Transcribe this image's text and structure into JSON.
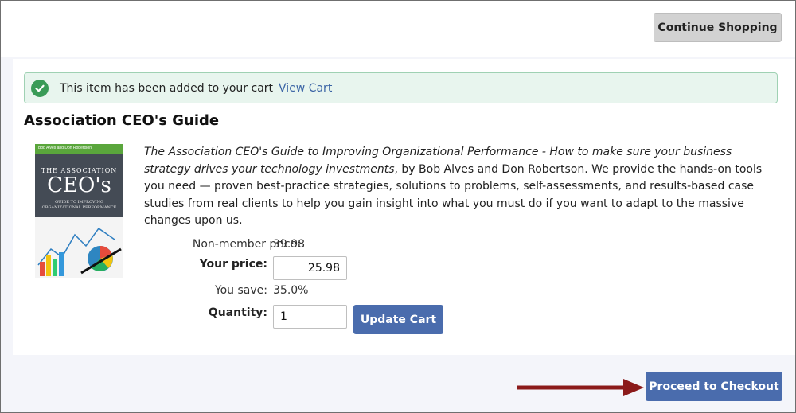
{
  "header": {
    "continue_label": "Continue Shopping"
  },
  "alert": {
    "message": "This item has been added to your cart",
    "link_label": "View Cart"
  },
  "product": {
    "title": "Association CEO's Guide",
    "cover": {
      "authors": "Bob Alves and Don Robertson",
      "line1": "THE ASSOCIATION",
      "line2": "CEO's",
      "subtitle": "GUIDE TO IMPROVING ORGANIZATIONAL PERFORMANCE"
    },
    "description_italic": "The Association CEO's Guide to Improving Organizational Performance - How to make sure your business strategy drives your technology investments",
    "description_rest": ", by Bob Alves and Don Robertson. We provide the hands-on tools you need — proven best-practice strategies, solutions to problems, self-assessments, and results-based case studies from real clients to help you gain insight into what you must do if you want to adapt to the massive changes upon us."
  },
  "pricing": {
    "nonmember_label": "Non-member price:",
    "nonmember_value": "39.98",
    "your_price_label": "Your price:",
    "your_price_value": "25.98",
    "you_save_label": "You save:",
    "you_save_value": "35.0%",
    "quantity_label": "Quantity:",
    "quantity_value": "1",
    "update_label": "Update Cart"
  },
  "footer": {
    "checkout_label": "Proceed to Checkout"
  },
  "colors": {
    "primary": "#4a6cad",
    "success": "#3a9b57",
    "arrow": "#8b1a1a"
  }
}
